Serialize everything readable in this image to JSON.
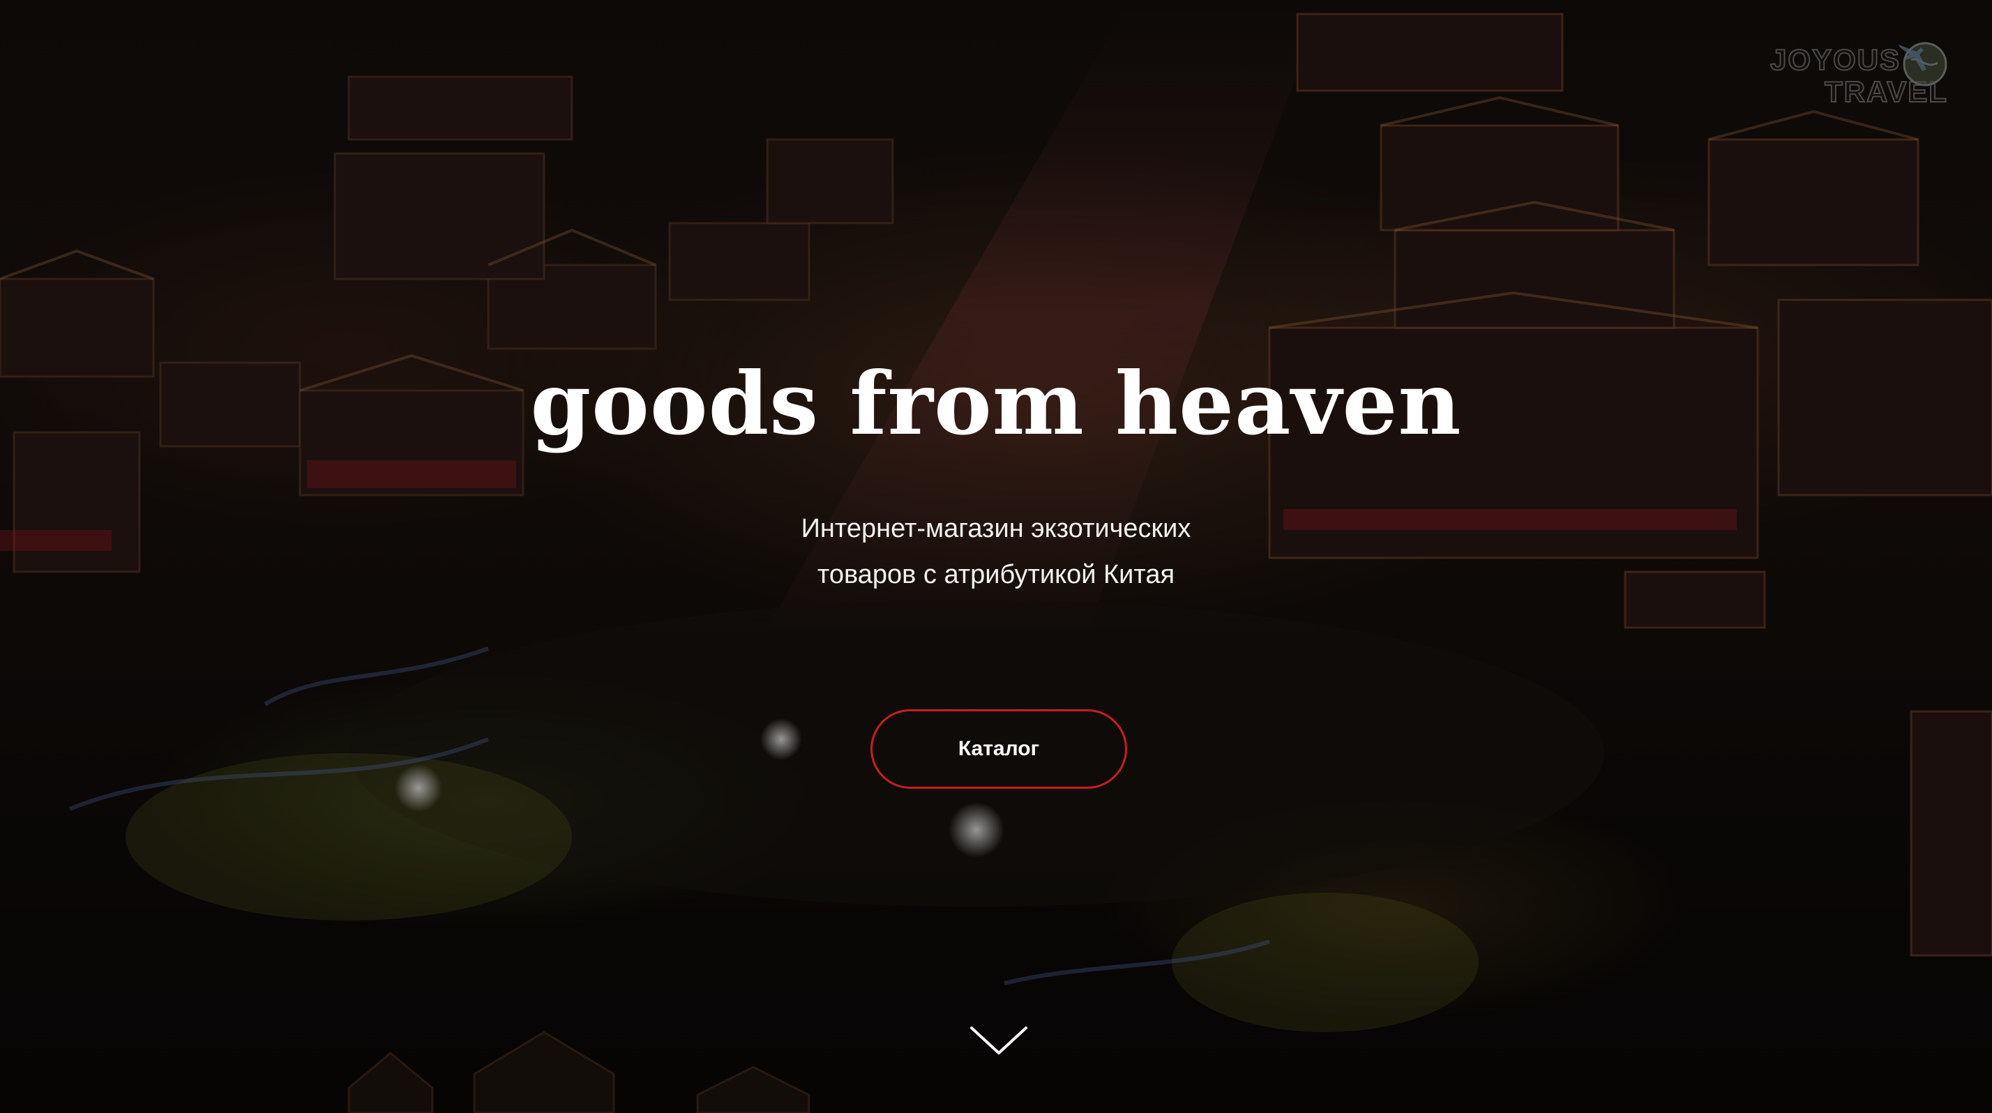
{
  "hero": {
    "title": "goods from heaven",
    "subtitle_lines": [
      "Интернет-магазин экзотических",
      "товаров с атрибутикой Китая"
    ],
    "cta_label": "Каталог",
    "scroll_icon": "chevron-down-icon"
  },
  "logo": {
    "line1": "JOYOUS",
    "line2": "TRAVEL",
    "icon": "globe-airplane-icon"
  },
  "colors": {
    "accent": "#c81e1e",
    "text": "#ffffff",
    "overlay": "#000000"
  }
}
